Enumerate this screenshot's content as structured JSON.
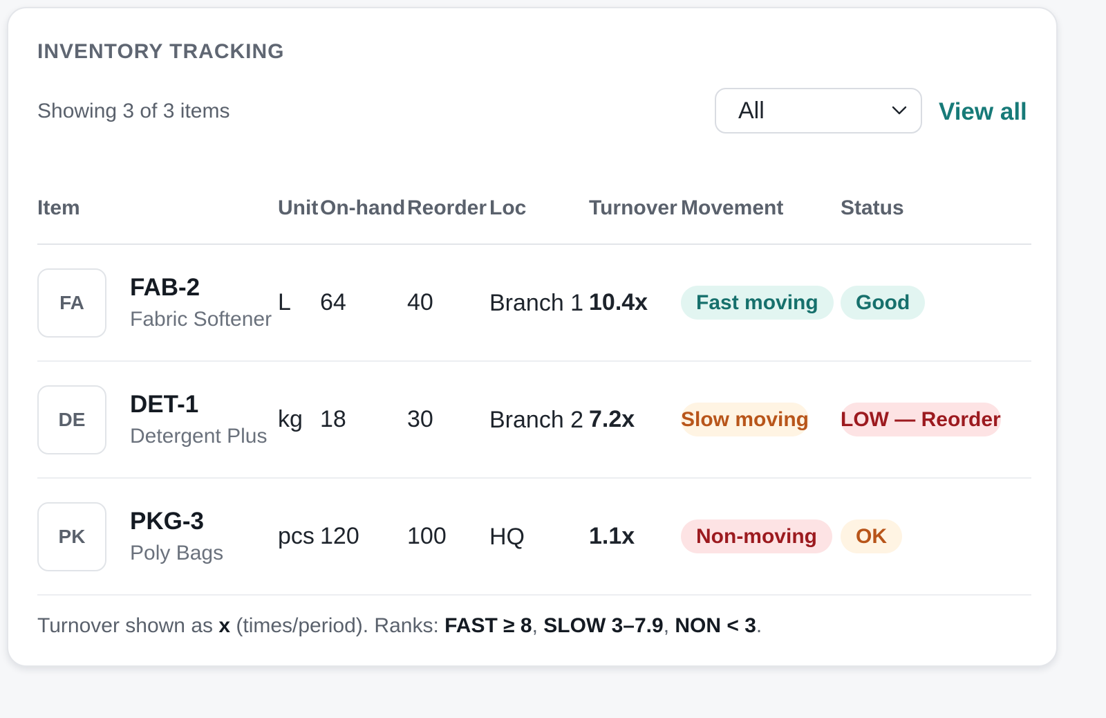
{
  "card": {
    "title": "INVENTORY TRACKING",
    "showing": "Showing 3 of 3 items",
    "filter_value": "All",
    "view_all": "View all"
  },
  "table": {
    "headers": {
      "item": "Item",
      "unit": "Unit",
      "onhand": "On-hand",
      "reorder": "Reorder",
      "loc": "Loc",
      "turnover": "Turnover",
      "movement": "Movement",
      "status": "Status"
    },
    "rows": [
      {
        "initials": "FA",
        "sku": "FAB-2",
        "name": "Fabric Softener",
        "unit": "L",
        "onhand": "64",
        "reorder": "40",
        "loc": "Branch 1",
        "turnover": "10.4x",
        "movement": "Fast moving",
        "status": "Good"
      },
      {
        "initials": "DE",
        "sku": "DET-1",
        "name": "Detergent Plus",
        "unit": "kg",
        "onhand": "18",
        "reorder": "30",
        "loc": "Branch 2",
        "turnover": "7.2x",
        "movement": "Slow moving",
        "status": "LOW — Reorder"
      },
      {
        "initials": "PK",
        "sku": "PKG-3",
        "name": "Poly Bags",
        "unit": "pcs",
        "onhand": "120",
        "reorder": "100",
        "loc": "HQ",
        "turnover": "1.1x",
        "movement": "Non-moving",
        "status": "OK"
      }
    ]
  },
  "footnote": {
    "prefix": "Turnover shown as ",
    "x": "x",
    "mid": " (times/period). Ranks: ",
    "fast": "FAST ≥ 8",
    "sep1": ", ",
    "slow": "SLOW 3–7.9",
    "sep2": ", ",
    "non": "NON < 3",
    "end": "."
  },
  "colors": {
    "accent": "#177a78",
    "fast_bg": "#e2f5f1",
    "slow_bg": "#fff4e3",
    "non_bg": "#fde3e4"
  },
  "icons": {
    "filter_toggle": "chevron-down-icon"
  }
}
